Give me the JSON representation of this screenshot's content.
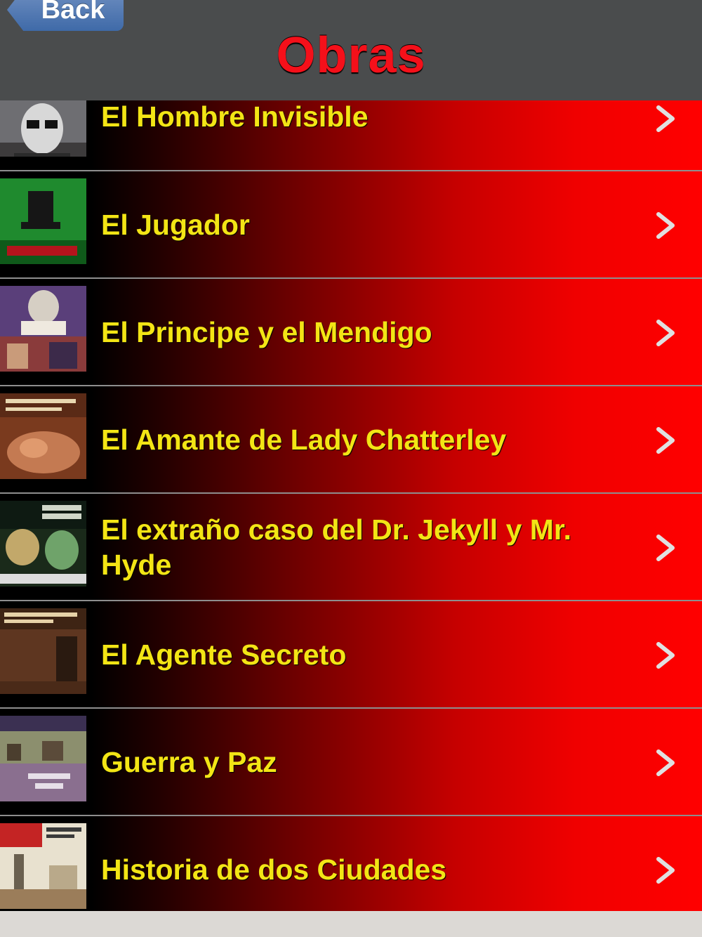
{
  "navbar": {
    "back_label": "Back",
    "title": "Obras"
  },
  "items": [
    {
      "title": "El Hombre Invisible",
      "thumb": "invisible-man-cover"
    },
    {
      "title": "El Jugador",
      "thumb": "el-jugador-cover"
    },
    {
      "title": "El Principe y el Mendigo",
      "thumb": "principe-mendigo-cover"
    },
    {
      "title": "El Amante de Lady Chatterley",
      "thumb": "lady-chatterley-cover"
    },
    {
      "title": "El extraño caso del Dr. Jekyll y Mr. Hyde",
      "thumb": "jekyll-hyde-cover"
    },
    {
      "title": "El Agente Secreto",
      "thumb": "agente-secreto-cover"
    },
    {
      "title": "Guerra y Paz",
      "thumb": "guerra-paz-cover"
    },
    {
      "title": "Historia de dos Ciudades",
      "thumb": "dos-ciudades-cover"
    }
  ],
  "colors": {
    "title_red": "#f5101a",
    "item_text": "#f3e515",
    "navbar_bg": "#4a4c4d"
  }
}
